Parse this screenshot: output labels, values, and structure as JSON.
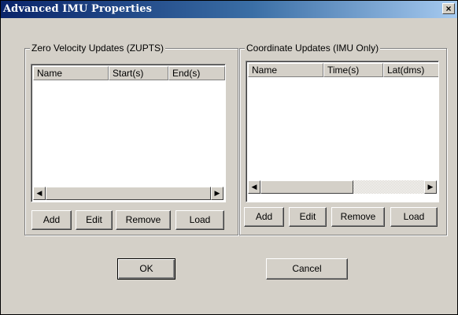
{
  "window": {
    "title": "Advanced IMU Properties",
    "close_label": "×"
  },
  "zupts": {
    "group_title": "Zero Velocity Updates (ZUPTS)",
    "columns": [
      "Name",
      "Start(s)",
      "End(s)"
    ],
    "rows": [],
    "scroll_left": "◀",
    "scroll_right": "▶",
    "buttons": {
      "add": "Add",
      "edit": "Edit",
      "remove": "Remove",
      "load": "Load"
    }
  },
  "coords": {
    "group_title": "Coordinate Updates (IMU Only)",
    "columns": [
      "Name",
      "Time(s)",
      "Lat(dms)"
    ],
    "rows": [],
    "scroll_left": "◀",
    "scroll_right": "▶",
    "buttons": {
      "add": "Add",
      "edit": "Edit",
      "remove": "Remove",
      "load": "Load"
    }
  },
  "dialog_buttons": {
    "ok": "OK",
    "cancel": "Cancel"
  },
  "colors": {
    "title_start": "#0a246a",
    "title_end": "#a6caf0",
    "face": "#d4d0c8"
  }
}
